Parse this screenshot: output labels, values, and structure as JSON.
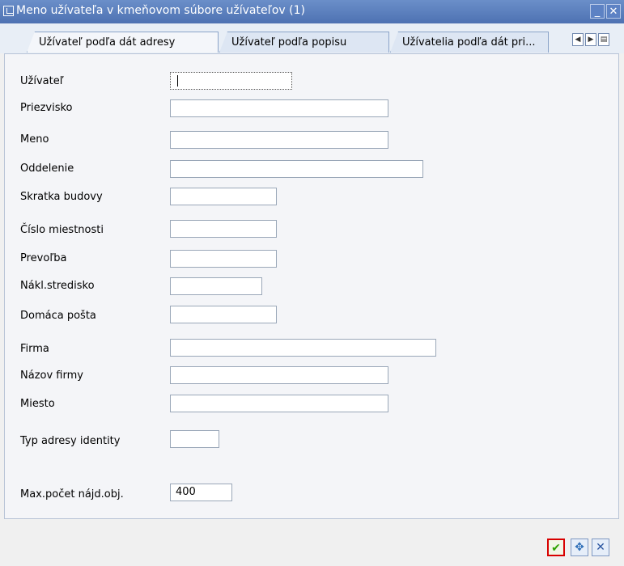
{
  "window": {
    "title": "Meno užívateľa v kmeňovom súbore užívateľov (1)"
  },
  "tabs": [
    {
      "label": "Užívateľ podľa dát adresy",
      "active": true
    },
    {
      "label": "Užívateľ podľa popisu",
      "active": false
    },
    {
      "label": "Užívatelia podľa dát pri...",
      "active": false
    }
  ],
  "fields": [
    {
      "label": "Užívateľ",
      "value": ""
    },
    {
      "label": "Priezvisko",
      "value": ""
    },
    {
      "label": "Meno",
      "value": ""
    },
    {
      "label": "Oddelenie",
      "value": ""
    },
    {
      "label": "Skratka budovy",
      "value": ""
    },
    {
      "label": "Číslo miestnosti",
      "value": ""
    },
    {
      "label": "Prevoľba",
      "value": ""
    },
    {
      "label": "Nákl.stredisko",
      "value": ""
    },
    {
      "label": "Domáca pošta",
      "value": ""
    },
    {
      "label": "Firma",
      "value": ""
    },
    {
      "label": "Názov firmy",
      "value": ""
    },
    {
      "label": "Miesto",
      "value": ""
    },
    {
      "label": "Typ adresy identity",
      "value": ""
    }
  ],
  "max_hits": {
    "label": "Max.počet nájd.obj.",
    "value": "400"
  },
  "toolbar": {
    "ok_icon": "check-icon",
    "search_icon": "search-help-icon",
    "cancel_icon": "close-icon"
  },
  "colors": {
    "title_bar": "#4e71b2",
    "ok_highlight": "#d80000",
    "ok_check": "#2ea300"
  }
}
